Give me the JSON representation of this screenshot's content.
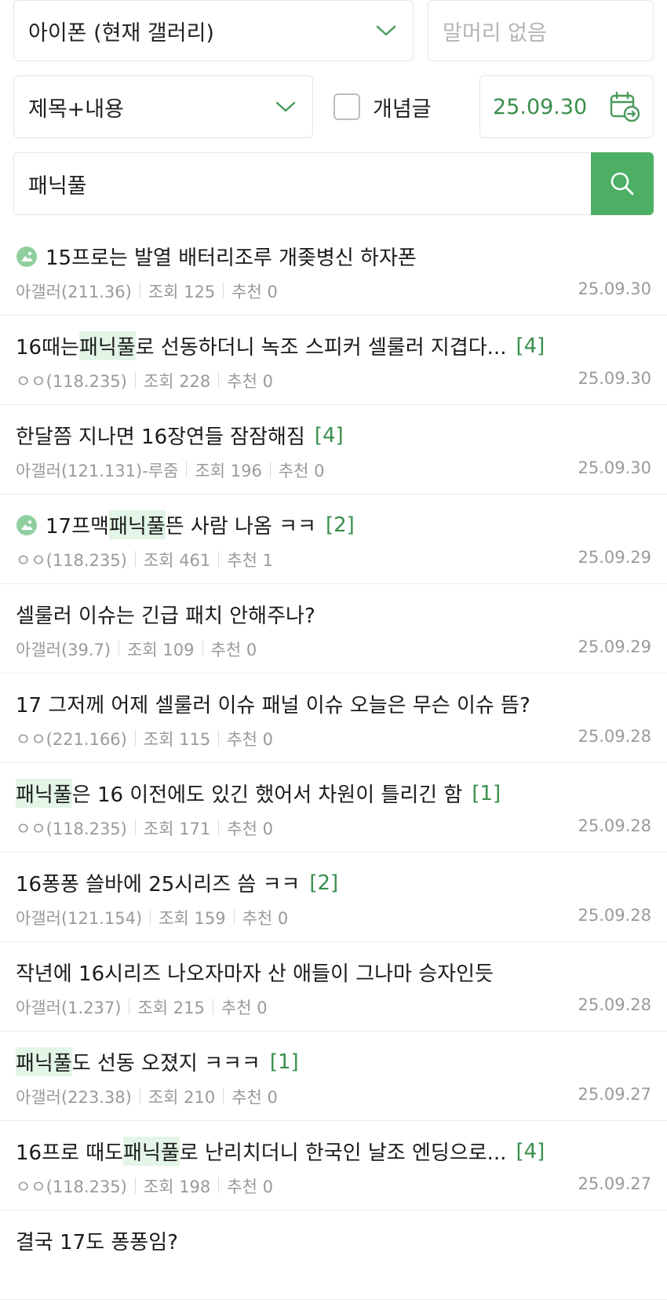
{
  "filters": {
    "gallery": "아이폰 (현재 갤러리)",
    "prefix_placeholder": "말머리 없음",
    "search_field": "제목+내용",
    "concept_label": "개념글",
    "date": "25.09.30",
    "query": "패닉풀"
  },
  "colors": {
    "accent": "#4caf64",
    "accent_text": "#3a8f4d",
    "highlight": "#e3f5e6"
  },
  "posts": [
    {
      "title_before": "15프로는 발열 배터리조루 개좆병신 하자폰",
      "hl": "",
      "title_after": "",
      "comments": "",
      "author": "아갤러(211.36)",
      "views": "조회 125",
      "recommends": "추천 0",
      "date": "25.09.30",
      "has_image": true
    },
    {
      "title_before": "16때는 ",
      "hl": "패닉풀",
      "title_after": "로 선동하더니 녹조 스피커 셀룰러 지겹다...",
      "comments": "[4]",
      "author": "ㅇㅇ(118.235)",
      "views": "조회 228",
      "recommends": "추천 0",
      "date": "25.09.30",
      "has_image": false
    },
    {
      "title_before": "한달쯤 지나면 16장연들 잠잠해짐",
      "hl": "",
      "title_after": "",
      "comments": "[4]",
      "author": "아갤러(121.131)-루줌",
      "views": "조회 196",
      "recommends": "추천 0",
      "date": "25.09.30",
      "has_image": false
    },
    {
      "title_before": "17프맥 ",
      "hl": "패닉풀",
      "title_after": " 뜬 사람 나옴 ㅋㅋ",
      "comments": "[2]",
      "author": "ㅇㅇ(118.235)",
      "views": "조회 461",
      "recommends": "추천 1",
      "date": "25.09.29",
      "has_image": true
    },
    {
      "title_before": "셀룰러 이슈는 긴급 패치 안해주나?",
      "hl": "",
      "title_after": "",
      "comments": "",
      "author": "아갤러(39.7)",
      "views": "조회 109",
      "recommends": "추천 0",
      "date": "25.09.29",
      "has_image": false
    },
    {
      "title_before": "17 그저께 어제 셀룰러 이슈 패널 이슈 오늘은 무슨 이슈 뜸?",
      "hl": "",
      "title_after": "",
      "comments": "",
      "author": "ㅇㅇ(221.166)",
      "views": "조회 115",
      "recommends": "추천 0",
      "date": "25.09.28",
      "has_image": false
    },
    {
      "title_before": "",
      "hl": "패닉풀",
      "title_after": "은 16 이전에도 있긴 했어서 차원이 틀리긴 함",
      "comments": "[1]",
      "author": "ㅇㅇ(118.235)",
      "views": "조회 171",
      "recommends": "추천 0",
      "date": "25.09.28",
      "has_image": false
    },
    {
      "title_before": "16퐁퐁 쓸바에 25시리즈 씀 ㅋㅋ",
      "hl": "",
      "title_after": "",
      "comments": "[2]",
      "author": "아갤러(121.154)",
      "views": "조회 159",
      "recommends": "추천 0",
      "date": "25.09.28",
      "has_image": false
    },
    {
      "title_before": "작년에 16시리즈 나오자마자 산 애들이 그나마 승자인듯",
      "hl": "",
      "title_after": "",
      "comments": "",
      "author": "아갤러(1.237)",
      "views": "조회 215",
      "recommends": "추천 0",
      "date": "25.09.28",
      "has_image": false
    },
    {
      "title_before": "",
      "hl": "패닉풀",
      "title_after": "도 선동 오졌지 ㅋㅋㅋ",
      "comments": "[1]",
      "author": "아갤러(223.38)",
      "views": "조회 210",
      "recommends": "추천 0",
      "date": "25.09.27",
      "has_image": false
    },
    {
      "title_before": "16프로 때도 ",
      "hl": "패닉풀",
      "title_after": "로 난리치더니 한국인 날조 엔딩으로...",
      "comments": "[4]",
      "author": "ㅇㅇ(118.235)",
      "views": "조회 198",
      "recommends": "추천 0",
      "date": "25.09.27",
      "has_image": false
    },
    {
      "title_before": "결국 17도 퐁퐁임?",
      "hl": "",
      "title_after": "",
      "comments": "",
      "author": "",
      "views": "",
      "recommends": "",
      "date": "",
      "has_image": false
    }
  ]
}
